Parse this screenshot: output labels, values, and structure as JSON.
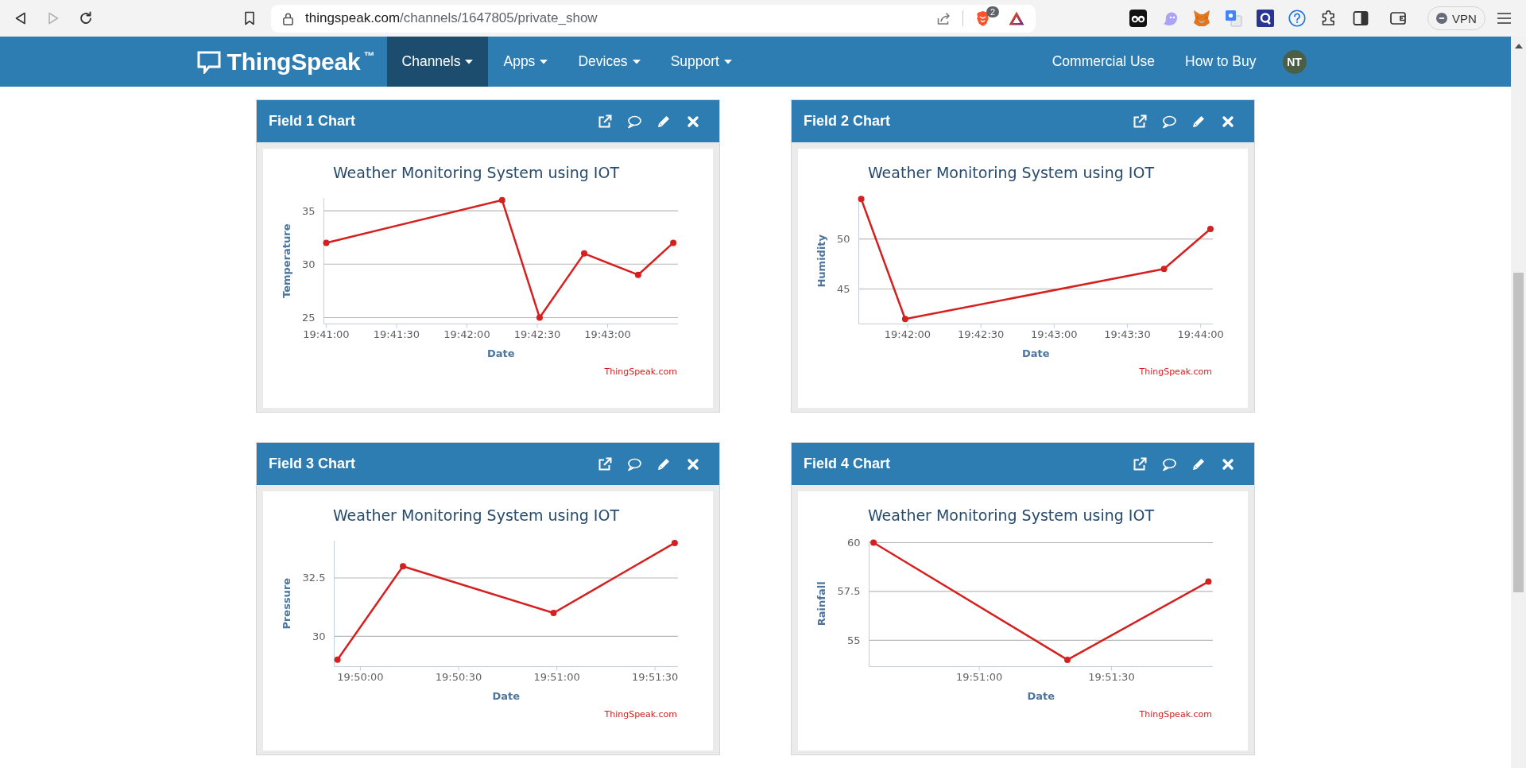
{
  "browser": {
    "nav_buttons": [
      {
        "kind": "back",
        "disabled": false
      },
      {
        "kind": "forward",
        "disabled": true
      },
      {
        "kind": "reload",
        "disabled": false
      }
    ],
    "address_bar": {
      "host": "thingspeak.com",
      "path": "/channels/1647805/private_show"
    },
    "shield_badge": "2",
    "vpn_button": {
      "label": "VPN"
    }
  },
  "navbar": {
    "brand": "ThingSpeak",
    "brand_mark": "™",
    "items": [
      {
        "label": "Channels",
        "selected": true,
        "dropdown": true
      },
      {
        "label": "Apps",
        "selected": false,
        "dropdown": true
      },
      {
        "label": "Devices",
        "selected": false,
        "dropdown": true
      },
      {
        "label": "Support",
        "selected": false,
        "dropdown": true
      }
    ],
    "right_items": [
      {
        "label": "Commercial Use",
        "selected": false,
        "dropdown": false
      },
      {
        "label": "How to Buy",
        "selected": false,
        "dropdown": false
      }
    ],
    "avatar": {
      "initials": "NT"
    }
  },
  "cards": [
    {
      "title": "Field 1 Chart",
      "credits": "ThingSpeak.com",
      "chart_data": {
        "type": "line",
        "title": "Weather Monitoring System using IOT",
        "xlabel": "Date",
        "ylabel": "Temperature",
        "grid": true,
        "x": [
          70860,
          70935,
          70951,
          70970,
          70993,
          71008
        ],
        "series": [
          {
            "color": "#d62020",
            "marker": true,
            "values": [
              32,
              36,
              25,
              31,
              29,
              32
            ]
          }
        ],
        "xlim": [
          70859,
          71010
        ],
        "ylim": [
          24.4,
          36.2
        ],
        "xticks": [
          {
            "value": 70860,
            "label": "19:41:00"
          },
          {
            "value": 70890,
            "label": "19:41:30"
          },
          {
            "value": 70920,
            "label": "19:42:00"
          },
          {
            "value": 70950,
            "label": "19:42:30"
          },
          {
            "value": 70980,
            "label": "19:43:00"
          }
        ],
        "yticks": [
          25,
          30,
          35
        ]
      }
    },
    {
      "title": "Field 2 Chart",
      "credits": "ThingSpeak.com",
      "chart_data": {
        "type": "line",
        "title": "Weather Monitoring System using IOT",
        "xlabel": "Date",
        "ylabel": "Humidity",
        "grid": true,
        "x": [
          70901,
          70919,
          71025,
          71044
        ],
        "series": [
          {
            "color": "#d62020",
            "marker": true,
            "values": [
              54,
              42,
              47,
              51
            ]
          }
        ],
        "xlim": [
          70900,
          71045
        ],
        "ylim": [
          41.5,
          54.1
        ],
        "xticks": [
          {
            "value": 70920,
            "label": "19:42:00"
          },
          {
            "value": 70950,
            "label": "19:42:30"
          },
          {
            "value": 70980,
            "label": "19:43:00"
          },
          {
            "value": 71010,
            "label": "19:43:30"
          },
          {
            "value": 71040,
            "label": "19:44:00"
          }
        ],
        "yticks": [
          45,
          50
        ]
      }
    },
    {
      "title": "Field 3 Chart",
      "credits": "ThingSpeak.com",
      "chart_data": {
        "type": "line",
        "title": "Weather Monitoring System using IOT",
        "xlabel": "Date",
        "ylabel": "Pressure",
        "grid": true,
        "x": [
          71393,
          71413,
          71459,
          71496
        ],
        "series": [
          {
            "color": "#d62020",
            "marker": true,
            "values": [
              29,
              33,
              31,
              34
            ]
          }
        ],
        "xlim": [
          71392,
          71497
        ],
        "ylim": [
          28.7,
          34.1
        ],
        "xticks": [
          {
            "value": 71400,
            "label": "19:50:00"
          },
          {
            "value": 71430,
            "label": "19:50:30"
          },
          {
            "value": 71460,
            "label": "19:51:00"
          },
          {
            "value": 71490,
            "label": "19:51:30"
          }
        ],
        "yticks": [
          30,
          32.5
        ]
      }
    },
    {
      "title": "Field 4 Chart",
      "credits": "ThingSpeak.com",
      "chart_data": {
        "type": "line",
        "title": "Weather Monitoring System using IOT",
        "xlabel": "Date",
        "ylabel": "Rainfall",
        "grid": true,
        "x": [
          71436,
          71480,
          71512
        ],
        "series": [
          {
            "color": "#d62020",
            "marker": true,
            "values": [
              60,
              54,
              58
            ]
          }
        ],
        "xlim": [
          71435,
          71513
        ],
        "ylim": [
          53.65,
          60.1
        ],
        "xticks": [
          {
            "value": 71460,
            "label": "19:51:00"
          },
          {
            "value": 71490,
            "label": "19:51:30"
          }
        ],
        "yticks": [
          55,
          57.5,
          60
        ]
      }
    }
  ]
}
